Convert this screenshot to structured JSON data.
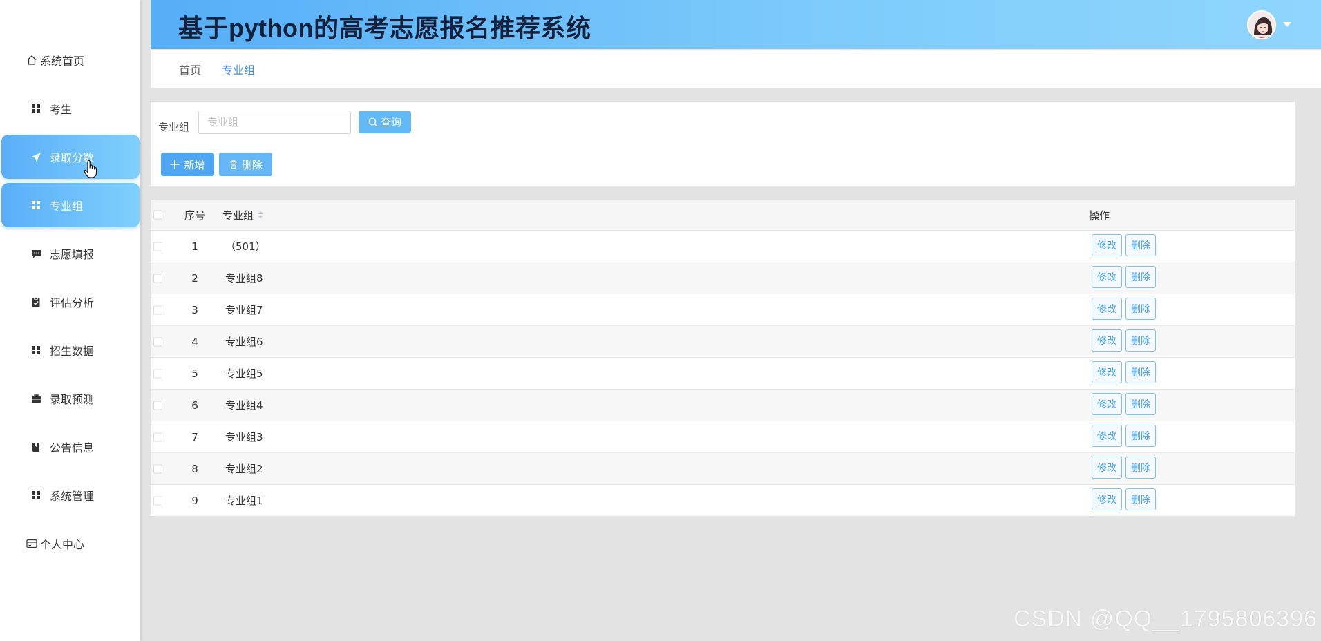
{
  "sidebar": {
    "items": [
      {
        "label": "系统首页",
        "icon": "home-icon",
        "level": "top",
        "active": false
      },
      {
        "label": "考生",
        "icon": "grid-icon",
        "level": "sub",
        "active": false
      },
      {
        "label": "录取分数",
        "icon": "paper-plane-icon",
        "level": "sub",
        "active": true
      },
      {
        "label": "专业组",
        "icon": "grid-icon",
        "level": "sub",
        "active": true
      },
      {
        "label": "志愿填报",
        "icon": "chat-icon",
        "level": "sub",
        "active": false
      },
      {
        "label": "评估分析",
        "icon": "clipboard-icon",
        "level": "sub",
        "active": false
      },
      {
        "label": "招生数据",
        "icon": "grid-icon",
        "level": "sub",
        "active": false
      },
      {
        "label": "录取预测",
        "icon": "briefcase-icon",
        "level": "sub",
        "active": false
      },
      {
        "label": "公告信息",
        "icon": "book-icon",
        "level": "sub",
        "active": false
      },
      {
        "label": "系统管理",
        "icon": "grid-icon",
        "level": "sub",
        "active": false
      },
      {
        "label": "个人中心",
        "icon": "card-icon",
        "level": "top",
        "active": false
      }
    ]
  },
  "header": {
    "title": "基于python的高考志愿报名推荐系统"
  },
  "breadcrumb": {
    "home": "首页",
    "current": "专业组"
  },
  "search": {
    "label": "专业组",
    "placeholder": "专业组",
    "value": "",
    "query_label": "查询"
  },
  "actions": {
    "add_label": "新增",
    "delete_label": "删除"
  },
  "table": {
    "headers": {
      "index": "序号",
      "name": "专业组",
      "ops": "操作"
    },
    "edit_label": "修改",
    "delete_label": "删除",
    "rows": [
      {
        "index": "1",
        "name": "（501）"
      },
      {
        "index": "2",
        "name": "专业组8"
      },
      {
        "index": "3",
        "name": "专业组7"
      },
      {
        "index": "4",
        "name": "专业组6"
      },
      {
        "index": "5",
        "name": "专业组5"
      },
      {
        "index": "6",
        "name": "专业组4"
      },
      {
        "index": "7",
        "name": "专业组3"
      },
      {
        "index": "8",
        "name": "专业组2"
      },
      {
        "index": "9",
        "name": "专业组1"
      }
    ]
  },
  "watermark": "CSDN @QQ__1795806396",
  "colors": {
    "accent": "#4fa6f3",
    "header_gradient_start": "#55aef7",
    "header_gradient_end": "#8fd6fd",
    "active_menu": "#5aaef8",
    "link": "#3a8fd9"
  }
}
